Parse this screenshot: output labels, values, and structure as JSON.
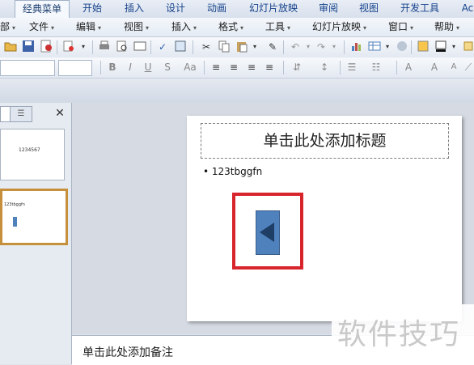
{
  "ribbon_tabs": [
    {
      "label": "经典菜单",
      "active": true
    },
    {
      "label": "开始",
      "active": false
    },
    {
      "label": "插入",
      "active": false
    },
    {
      "label": "设计",
      "active": false
    },
    {
      "label": "动画",
      "active": false
    },
    {
      "label": "幻灯片放映",
      "active": false
    },
    {
      "label": "审阅",
      "active": false
    },
    {
      "label": "视图",
      "active": false
    },
    {
      "label": "开发工具",
      "active": false
    },
    {
      "label": "Ac",
      "active": false
    }
  ],
  "menu": [
    "部",
    "文件",
    "编辑",
    "视图",
    "插入",
    "格式",
    "工具",
    "幻灯片放映",
    "窗口",
    "帮助"
  ],
  "slide": {
    "title_placeholder": "单击此处添加标题",
    "bullet": "123tbggfn"
  },
  "thumbnails": [
    {
      "label": "1234567"
    },
    {
      "label": "123tbggfn"
    }
  ],
  "notes_placeholder": "单击此处添加备注",
  "watermark": "软件技巧",
  "colors": {
    "highlight_border": "#d8242c",
    "action_button": "#4f81bd",
    "selected_thumb": "#c68f3b"
  }
}
